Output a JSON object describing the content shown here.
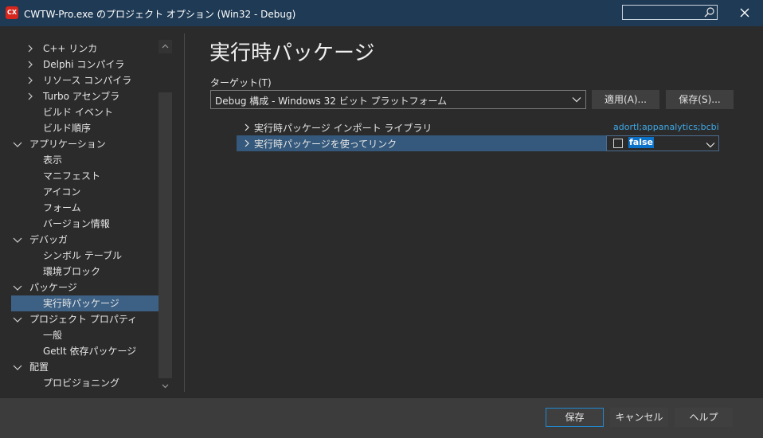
{
  "window": {
    "title": "CWTW-Pro.exe のプロジェクト オプション  (Win32 - Debug)",
    "app_icon_text": "CX"
  },
  "sidebar": {
    "items": [
      {
        "label": "C++ リンカ",
        "expandable": true,
        "expanded": false,
        "level": 1
      },
      {
        "label": "Delphi コンパイラ",
        "expandable": true,
        "expanded": false,
        "level": 1
      },
      {
        "label": "リソース コンパイラ",
        "expandable": true,
        "expanded": false,
        "level": 1
      },
      {
        "label": "Turbo アセンブラ",
        "expandable": true,
        "expanded": false,
        "level": 1
      },
      {
        "label": "ビルド イベント",
        "expandable": false,
        "level": 2
      },
      {
        "label": "ビルド順序",
        "expandable": false,
        "level": 2
      },
      {
        "label": "アプリケーション",
        "expandable": true,
        "expanded": true,
        "level": 0
      },
      {
        "label": "表示",
        "expandable": false,
        "level": 2
      },
      {
        "label": "マニフェスト",
        "expandable": false,
        "level": 2
      },
      {
        "label": "アイコン",
        "expandable": false,
        "level": 2
      },
      {
        "label": "フォーム",
        "expandable": false,
        "level": 2
      },
      {
        "label": "バージョン情報",
        "expandable": false,
        "level": 2
      },
      {
        "label": "デバッガ",
        "expandable": true,
        "expanded": true,
        "level": 0
      },
      {
        "label": "シンボル テーブル",
        "expandable": false,
        "level": 2
      },
      {
        "label": "環境ブロック",
        "expandable": false,
        "level": 2
      },
      {
        "label": "パッケージ",
        "expandable": true,
        "expanded": true,
        "level": 0
      },
      {
        "label": "実行時パッケージ",
        "expandable": false,
        "level": 2,
        "selected": true
      },
      {
        "label": "プロジェクト プロパティ",
        "expandable": true,
        "expanded": true,
        "level": 0
      },
      {
        "label": "一般",
        "expandable": false,
        "level": 2
      },
      {
        "label": "GetIt 依存パッケージ",
        "expandable": false,
        "level": 2
      },
      {
        "label": "配置",
        "expandable": true,
        "expanded": true,
        "level": 0
      },
      {
        "label": "プロビジョニング",
        "expandable": false,
        "level": 2
      }
    ]
  },
  "main": {
    "title": "実行時パッケージ",
    "target_label": "ターゲット(T)",
    "target_value": "Debug 構成 - Windows 32 ビット プラットフォーム",
    "apply_label": "適用(A)...",
    "save_label": "保存(S)...",
    "properties": [
      {
        "name": "実行時パッケージ インポート ライブラリ",
        "value": "adortl;appanalytics;bcbie;"
      },
      {
        "name": "実行時パッケージを使ってリンク",
        "value": "false",
        "checked": false
      }
    ]
  },
  "footer": {
    "ok_label": "保存",
    "cancel_label": "キャンセル",
    "help_label": "ヘルプ"
  },
  "colors": {
    "titlebar": "#1f3a54",
    "background": "#2b2b2b",
    "selection": "#3d6185",
    "link_value": "#3fa9e8",
    "accent_border": "#1f8ad2"
  }
}
